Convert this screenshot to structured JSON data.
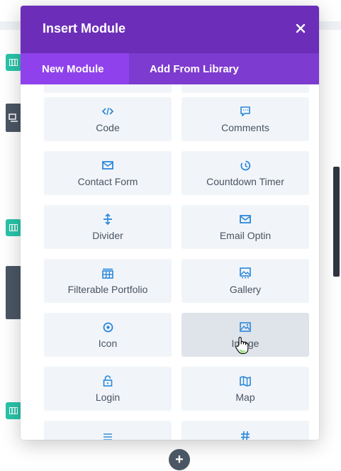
{
  "modal": {
    "title": "Insert Module",
    "close_icon": "close-icon",
    "tabs": [
      {
        "label": "New Module",
        "active": true
      },
      {
        "label": "Add From Library",
        "active": false
      }
    ]
  },
  "modules": [
    {
      "label": "Code",
      "icon": "code-icon"
    },
    {
      "label": "Comments",
      "icon": "comments-icon"
    },
    {
      "label": "Contact Form",
      "icon": "contact-form-icon"
    },
    {
      "label": "Countdown Timer",
      "icon": "countdown-timer-icon"
    },
    {
      "label": "Divider",
      "icon": "divider-icon"
    },
    {
      "label": "Email Optin",
      "icon": "email-optin-icon"
    },
    {
      "label": "Filterable Portfolio",
      "icon": "filterable-portfolio-icon"
    },
    {
      "label": "Gallery",
      "icon": "gallery-icon"
    },
    {
      "label": "Icon",
      "icon": "icon-module-icon"
    },
    {
      "label": "Image",
      "icon": "image-icon",
      "hovered": true
    },
    {
      "label": "Login",
      "icon": "login-icon"
    },
    {
      "label": "Map",
      "icon": "map-icon"
    }
  ],
  "colors": {
    "header": "#6c2eb9",
    "tab_bar": "#7d3bcf",
    "active_tab": "#8f42ec",
    "module_bg": "#f1f5f9",
    "module_icon": "#2b87da",
    "teal": "#29c4a9"
  },
  "add_button_label": "+"
}
